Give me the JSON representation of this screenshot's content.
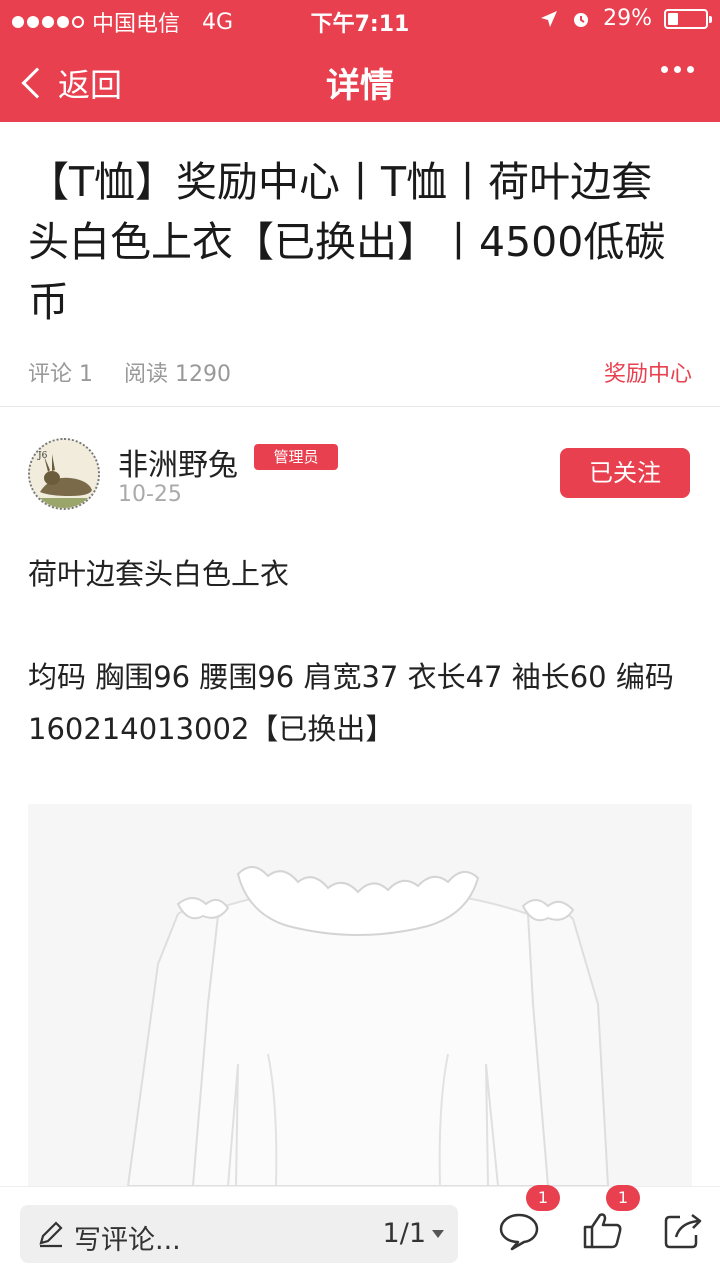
{
  "status_bar": {
    "carrier": "中国电信",
    "network": "4G",
    "time": "下午7:11",
    "battery": "29%",
    "battery_level": 0.29
  },
  "nav": {
    "back_label": "返回",
    "title": "详情"
  },
  "article": {
    "title": "【T恤】奖励中心丨T恤丨荷叶边套头白色上衣【已换出】丨4500低碳币",
    "comments_stat": "评论 1",
    "reads_stat": "阅读 1290",
    "category": "奖励中心"
  },
  "author": {
    "name": "非洲野兔",
    "role_badge": "管理员",
    "date": "10-25",
    "follow_label": "已关注"
  },
  "body": {
    "para1": "荷叶边套头白色上衣",
    "para2": "均码  胸围96  腰围96  肩宽37  衣长47  袖长60   编码160214013002【已换出】"
  },
  "bottom_bar": {
    "comment_placeholder": "写评论...",
    "pager": "1/1",
    "comment_count": "1",
    "like_count": "1"
  },
  "colors": {
    "accent": "#e8404f"
  }
}
